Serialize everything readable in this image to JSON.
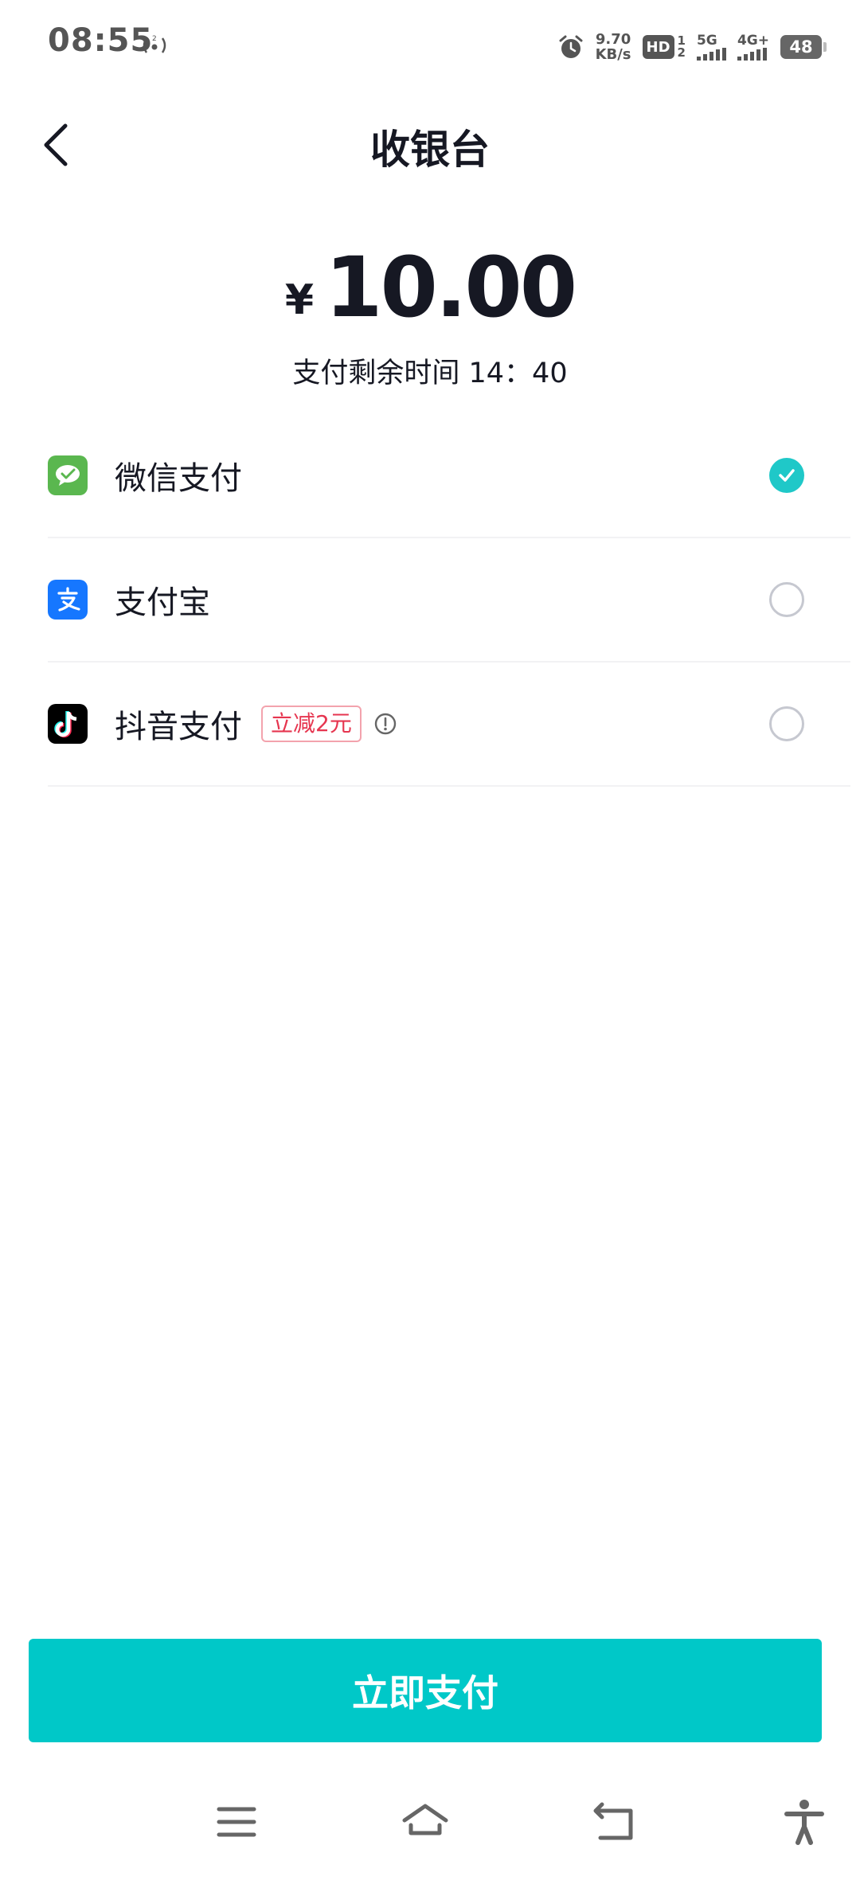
{
  "status_bar": {
    "time": "08:55",
    "net_speed_value": "9.70",
    "net_speed_unit": "KB/s",
    "hd_label": "HD",
    "sim_labels": [
      "1",
      "2"
    ],
    "sim1_network": "5G",
    "sim2_network": "4G+",
    "battery": "48"
  },
  "header": {
    "title": "收银台"
  },
  "payment": {
    "currency": "¥",
    "amount": "10.00",
    "countdown": "支付剩余时间 14：40"
  },
  "methods": [
    {
      "label": "微信支付",
      "selected": true,
      "icon": "wechat-pay-icon",
      "color": "#5ab74f"
    },
    {
      "label": "支付宝",
      "selected": false,
      "icon": "alipay-icon",
      "color": "#1677ff"
    },
    {
      "label": "抖音支付",
      "selected": false,
      "icon": "douyin-pay-icon",
      "color": "#000000",
      "promo": "立减2元"
    }
  ],
  "pay_button": {
    "label": "立即支付",
    "color": "#00c8c8"
  },
  "nav_bar": {
    "icons": [
      "menu-icon",
      "home-icon",
      "back-icon",
      "accessibility-icon"
    ]
  }
}
